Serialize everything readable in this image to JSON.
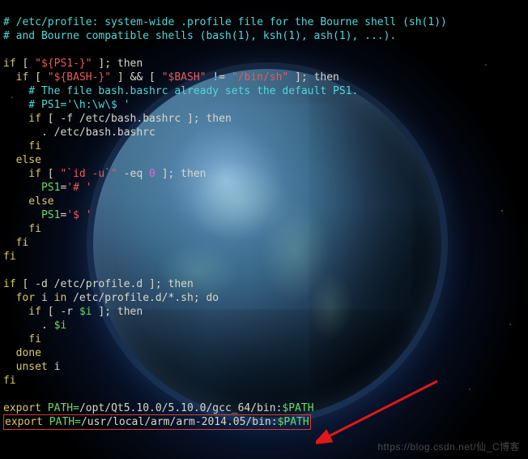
{
  "watermark": "https://blog.csdn.net/仙_C博客",
  "comment1": "# /etc/profile: system-wide .profile file for the Bourne shell (sh(1))",
  "comment2": "# and Bourne compatible shells (bash(1), ksh(1), ash(1), ...).",
  "l4_if": "if",
  "l4_br": " [ ",
  "l4_str": "\"${PS1-}\"",
  "l4_then": " ]; then",
  "l5_if": "  if",
  "l5_br": " [ ",
  "l5_s1": "\"${BASH-}\"",
  "l5_mid": " ] && [ ",
  "l5_s2": "\"$BASH\"",
  "l5_neq": " != ",
  "l5_s3": "\"/bin/sh\"",
  "l5_then": " ]; then",
  "l6": "    # The file bash.bashrc already sets the default PS1.",
  "l7": "    # PS1='\\h:\\w\\$ '",
  "l8_if": "    if",
  "l8_test": " [ -f /etc/bash.bashrc ]; then",
  "l9": "      . /etc/bash.bashrc",
  "l10": "    fi",
  "l11": "  else",
  "l12_if": "    if",
  "l12_br": " [ ",
  "l12_cmd": "\"`id -u`\"",
  "l12_eq": " -eq ",
  "l12_zero": "0",
  "l12_then": " ]; then",
  "l13_var": "      PS1",
  "l13_eq": "=",
  "l13_val": "'# '",
  "l14": "    else",
  "l15_var": "      PS1",
  "l15_eq": "=",
  "l15_val": "'$ '",
  "l16": "    fi",
  "l17": "  fi",
  "l18": "fi",
  "l20_if": "if",
  "l20_test": " [ -d /etc/profile.d ]; then",
  "l21_for": "  for",
  "l21_i": " i ",
  "l21_in": "in",
  "l21_glob": " /etc/profile.d/*.sh; do",
  "l22_if": "    if",
  "l22_br": " [ -r ",
  "l22_var": "$i",
  "l22_then": " ]; then",
  "l23_dot": "      . ",
  "l23_var": "$i",
  "l24": "    fi",
  "l25": "  done",
  "l26_unset": "  unset",
  "l26_i": " i",
  "l27": "fi",
  "e1_kw": "export",
  "e1_var": " PATH=",
  "e1_path": "/opt/Qt5.10.0/5.10.0/gcc_64/bin:",
  "e1_pvar": "$PATH",
  "e2_kw": "export",
  "e2_var": " PATH=",
  "e2_path": "/usr/local/arm/arm-2014.05/bin:",
  "e2_pvar": "$PATH"
}
